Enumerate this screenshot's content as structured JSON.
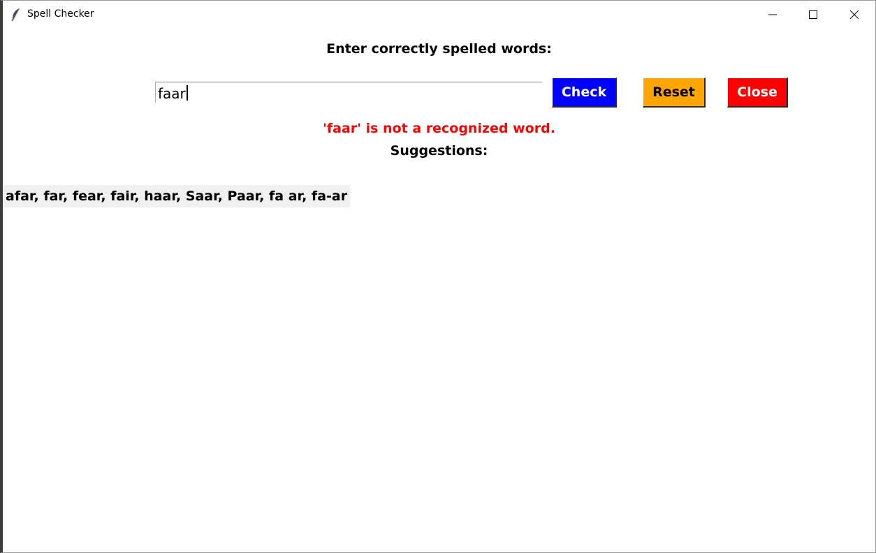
{
  "window": {
    "title": "Spell Checker",
    "icon": "feather-icon"
  },
  "prompt": {
    "label": "Enter correctly spelled words:"
  },
  "input": {
    "value": "faar"
  },
  "buttons": {
    "check": {
      "label": "Check",
      "bg": "#0000ff",
      "fg": "#ffffff"
    },
    "reset": {
      "label": "Reset",
      "bg": "#ffa500",
      "fg": "#000000"
    },
    "close": {
      "label": "Close",
      "bg": "#ff0000",
      "fg": "#ffffff"
    }
  },
  "result": {
    "message": "'faar' is not a recognized word.",
    "color": "#ff0000"
  },
  "suggestions": {
    "label": "Suggestions:",
    "text": "afar, far, fear, fair, haar, Saar, Paar, fa ar, fa-ar"
  }
}
